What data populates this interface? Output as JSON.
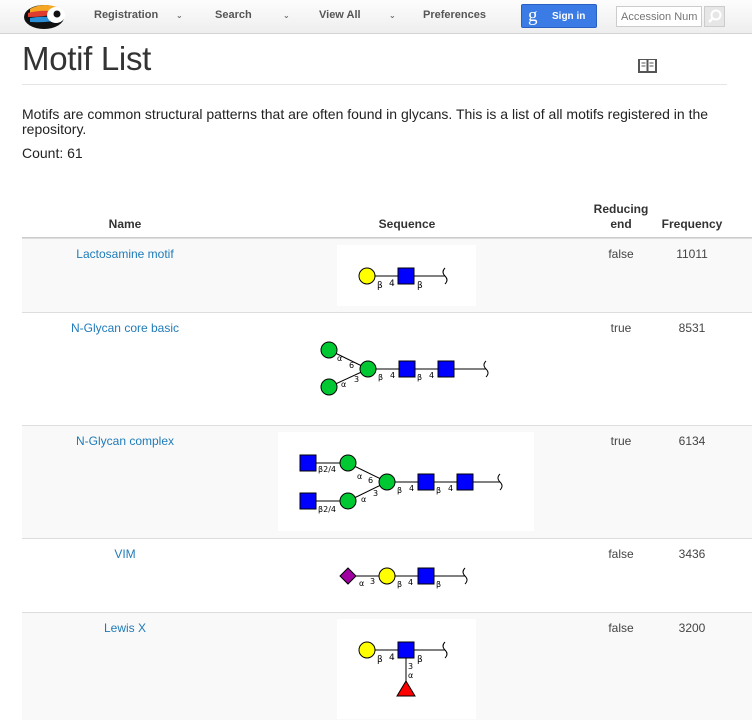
{
  "nav": {
    "registration": "Registration",
    "search": "Search",
    "view_all": "View All",
    "preferences": "Preferences",
    "sign_in_g": "g",
    "sign_in": "Sign in",
    "accession_placeholder": "Accession Numb"
  },
  "page": {
    "title": "Motif List",
    "description": "Motifs are common structural patterns that are often found in glycans. This is a list of all motifs registered in the repository.",
    "count": "Count: 61"
  },
  "table": {
    "headers": {
      "name": "Name",
      "sequence": "Sequence",
      "reducing_end": "Reducing end",
      "frequency": "Frequency"
    },
    "rows": [
      {
        "name": "Lactosamine motif",
        "reducing_end": "false",
        "frequency": "11011",
        "glycan": {
          "beta": "β",
          "four": "4"
        }
      },
      {
        "name": "N-Glycan core basic",
        "reducing_end": "true",
        "frequency": "8531",
        "glycan": {
          "alpha": "α",
          "six": "6",
          "three": "3",
          "beta": "β",
          "four": "4"
        }
      },
      {
        "name": "N-Glycan complex",
        "reducing_end": "true",
        "frequency": "6134",
        "glycan": {
          "b24": "β2/4",
          "alpha": "α",
          "six": "6",
          "three": "3",
          "beta": "β",
          "four": "4"
        }
      },
      {
        "name": "VIM",
        "reducing_end": "false",
        "frequency": "3436",
        "glycan": {
          "alpha": "α",
          "three": "3",
          "beta": "β",
          "four": "4"
        }
      },
      {
        "name": "Lewis X",
        "reducing_end": "false",
        "frequency": "3200",
        "glycan": {
          "beta": "β",
          "four": "4",
          "three": "3",
          "alpha": "α"
        }
      }
    ]
  },
  "colors": {
    "link": "#1f7bb8",
    "galactose_yellow": "#ffff00",
    "glcnac_blue": "#0000ff",
    "mannose_green": "#00c832",
    "neu5ac_purple": "#a000a0",
    "fucose_red": "#ff0000",
    "signin_blue": "#3b7be6"
  },
  "icons": {
    "logo": "toucan-logo",
    "search": "magnifier-icon",
    "book": "book-icon"
  }
}
